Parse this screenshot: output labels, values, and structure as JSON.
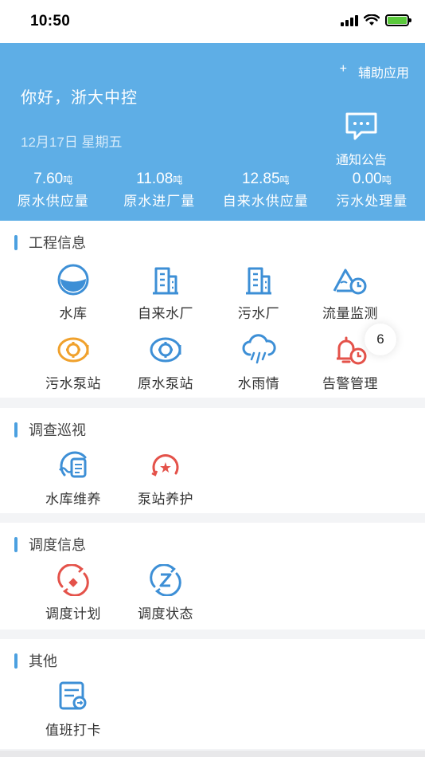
{
  "status": {
    "time": "10:50"
  },
  "header": {
    "aux_plus": "+",
    "aux_label": "辅助应用",
    "greeting": "你好，浙大中控",
    "date": "12月17日  星期五",
    "notice_label": "通知公告",
    "stats": [
      {
        "value": "7.60",
        "unit": "吨",
        "label": "原水供应量"
      },
      {
        "value": "11.08",
        "unit": "吨",
        "label": "原水进厂量"
      },
      {
        "value": "12.85",
        "unit": "吨",
        "label": "自来水供应量"
      },
      {
        "value": "0.00",
        "unit": "吨",
        "label": "污水处理量"
      }
    ]
  },
  "sections": {
    "engineering": {
      "title": "工程信息",
      "items": [
        "水库",
        "自来水厂",
        "污水厂",
        "流量监测",
        "污水泵站",
        "原水泵站",
        "水雨情",
        "告警管理"
      ],
      "alarm_badge": "6"
    },
    "inspection": {
      "title": "调查巡视",
      "items": [
        "水库维养",
        "泵站养护"
      ]
    },
    "dispatch": {
      "title": "调度信息",
      "items": [
        "调度计划",
        "调度状态"
      ]
    },
    "other": {
      "title": "其他",
      "items": [
        "值班打卡"
      ]
    }
  },
  "colors": {
    "header_bg": "#5eaee6",
    "icon_blue": "#3d8fd6",
    "icon_orange": "#f0a12c",
    "icon_red": "#e4524a"
  },
  "icons": [
    "reservoir-icon",
    "water-plant-icon",
    "sewage-plant-icon",
    "flow-monitor-icon",
    "sewage-pump-icon",
    "raw-pump-icon",
    "rain-icon",
    "alarm-icon",
    "reservoir-maintain-icon",
    "pump-maintain-icon",
    "dispatch-plan-icon",
    "dispatch-status-icon",
    "clock-in-icon",
    "notice-icon"
  ]
}
